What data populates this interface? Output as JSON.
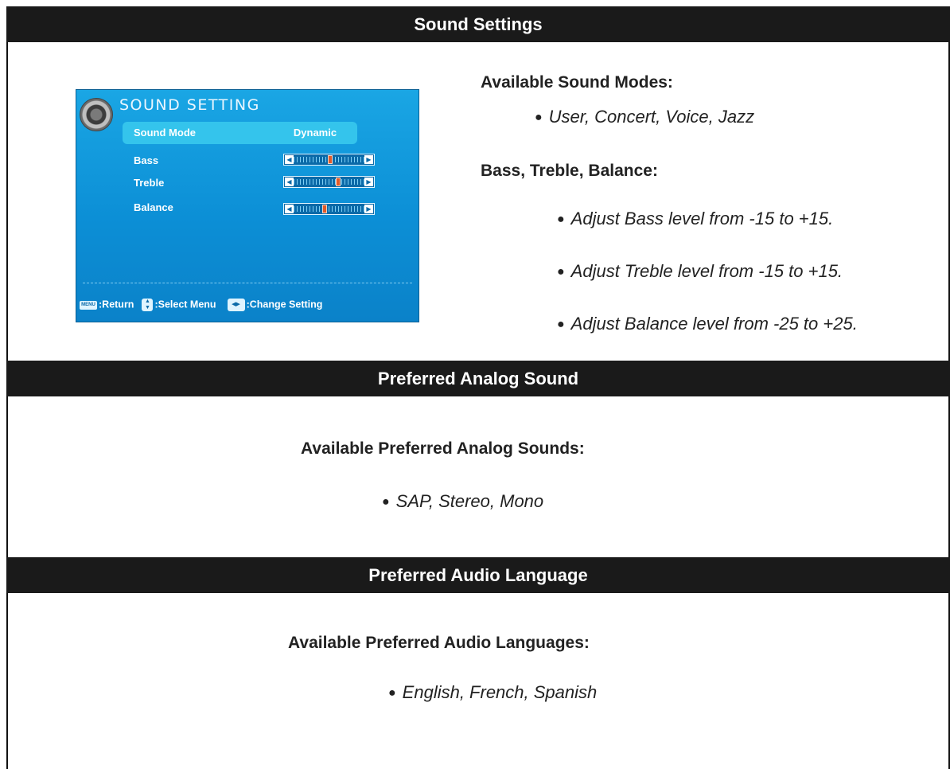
{
  "sections": {
    "sound_settings": {
      "title": "Sound Settings",
      "sound_modes_heading": "Available Sound Modes:",
      "sound_modes": "User, Concert, Voice, Jazz",
      "btb_heading": "Bass, Treble, Balance:",
      "btb_items": [
        "Adjust Bass level from -15 to +15.",
        "Adjust Treble level from -15 to +15.",
        "Adjust Balance level from -25 to +25."
      ]
    },
    "analog": {
      "title": "Preferred Analog Sound",
      "heading": "Available Preferred Analog Sounds:",
      "items": "SAP, Stereo, Mono"
    },
    "audio_language": {
      "title": "Preferred Audio Language",
      "heading": "Available Preferred Audio Languages:",
      "items": "English, French, Spanish"
    }
  },
  "tv_menu": {
    "title": "SOUND SETTING",
    "rows": {
      "sound_mode": {
        "label": "Sound Mode",
        "value": "Dynamic"
      },
      "bass": {
        "label": "Bass",
        "level": 0.5
      },
      "treble": {
        "label": "Treble",
        "level": 0.62
      },
      "balance": {
        "label": "Balance",
        "level": 0.42
      }
    },
    "footer": {
      "menu_key": "MENU",
      "return_label": ":Return",
      "select_label": ":Select Menu",
      "change_label": ":Change Setting"
    },
    "icons": {
      "disc": "speaker-disc-icon"
    }
  }
}
